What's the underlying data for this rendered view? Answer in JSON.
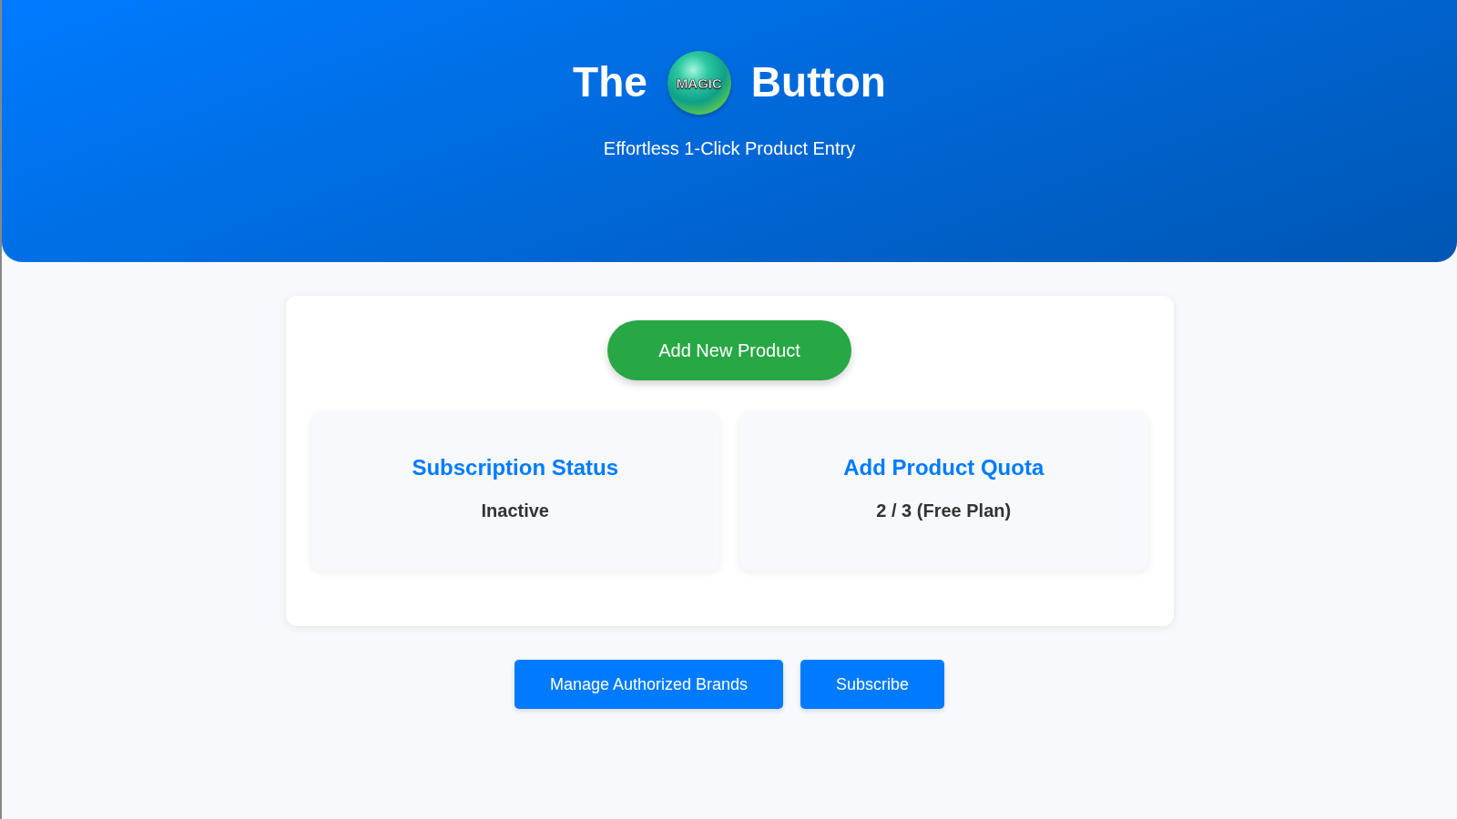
{
  "header": {
    "title_start": "The",
    "logo_text": "MAGIC",
    "title_end": "Button",
    "subtitle": "Effortless 1-Click Product Entry"
  },
  "main_action": {
    "label": "Add New Product"
  },
  "stats": [
    {
      "title": "Subscription Status",
      "value": "Inactive"
    },
    {
      "title": "Add Product Quota",
      "value": "2 / 3 (Free Plan)"
    }
  ],
  "buttons": [
    "Manage Authorized Brands",
    "Subscribe"
  ]
}
